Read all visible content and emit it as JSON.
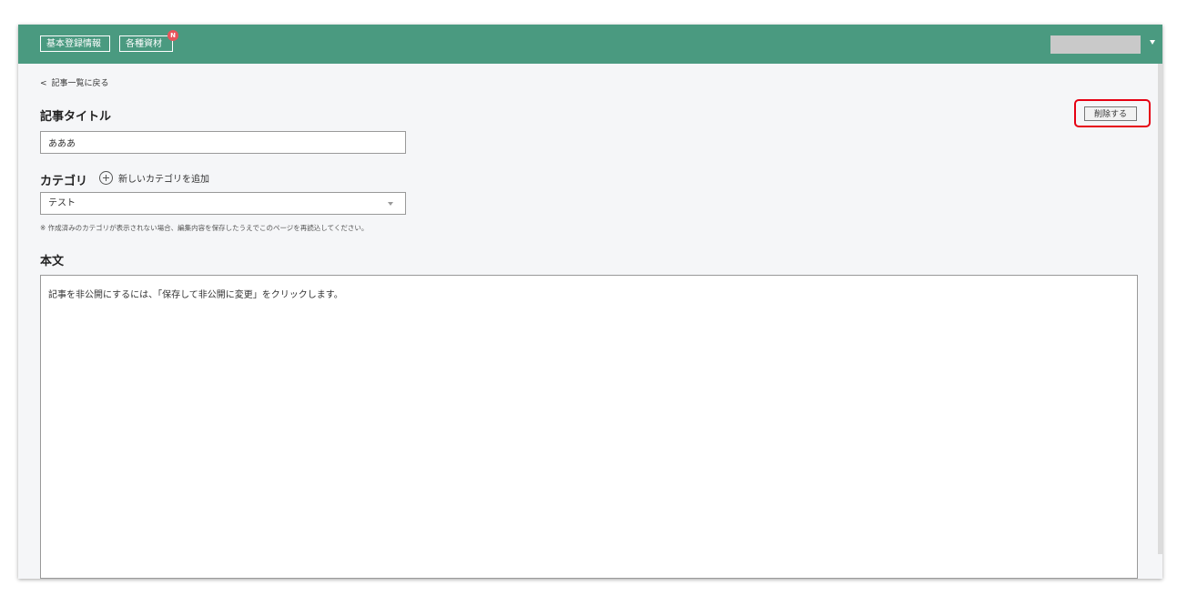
{
  "header": {
    "nav": [
      {
        "label": "基本登録情報"
      },
      {
        "label": "各種資材",
        "badge": "N"
      }
    ]
  },
  "back_link": {
    "label": "記事一覧に戻る",
    "icon": "chevron-left-icon"
  },
  "delete_button": {
    "label": "削除する"
  },
  "title_section": {
    "heading": "記事タイトル",
    "value": "あああ"
  },
  "category_section": {
    "heading": "カテゴリ",
    "add_label": "新しいカテゴリを追加",
    "selected": "テスト",
    "note": "※ 作成済みのカテゴリが表示されない場合、編集内容を保存したうえでこのページを再読込してください。"
  },
  "body_section": {
    "heading": "本文",
    "value": "記事を非公開にするには、「保存して非公開に変更」をクリックします。"
  },
  "colors": {
    "header_bg": "#4a9a80",
    "badge": "#e9545b",
    "highlight_border": "#e60012"
  }
}
